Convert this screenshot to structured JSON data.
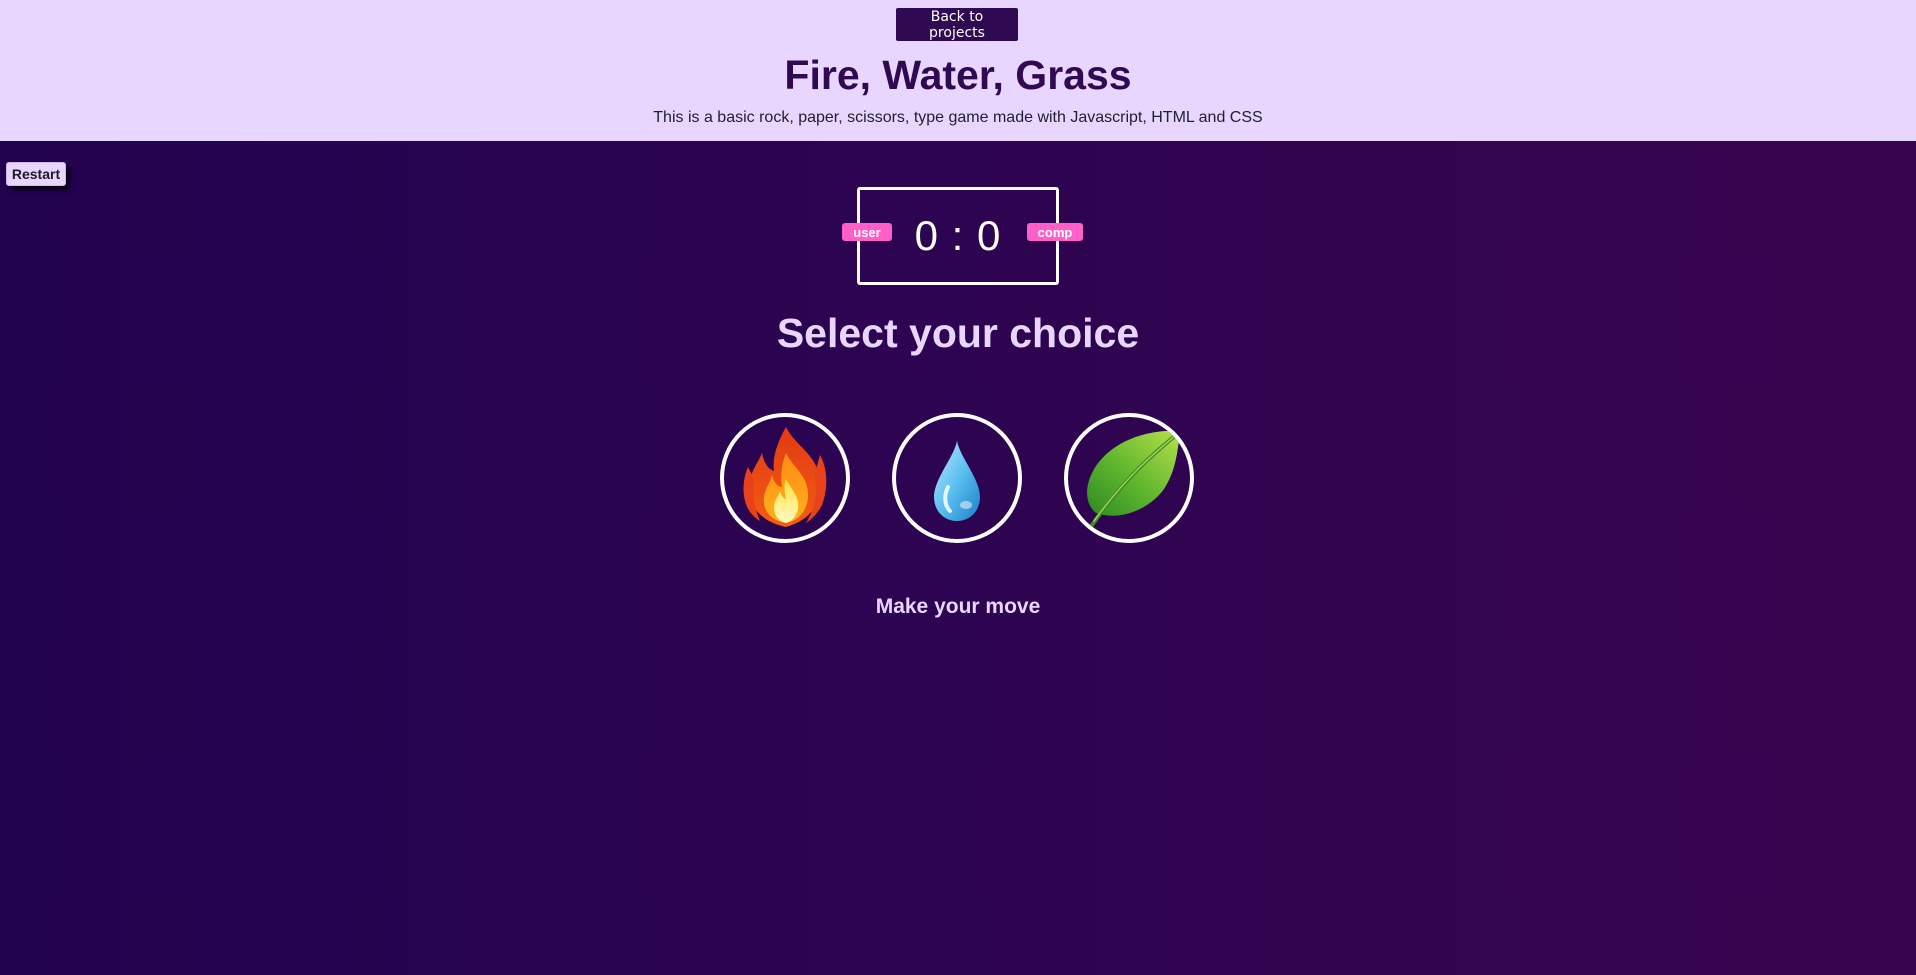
{
  "header": {
    "back_label": "Back to projects",
    "title": "Fire, Water, Grass",
    "subtitle": "This is a basic rock, paper, scissors, type game made with Javascript, HTML and CSS",
    "background_color": "#e8d6ff",
    "accent_color": "#2f0a52"
  },
  "game": {
    "restart_label": "Restart",
    "score": {
      "user_label": "user",
      "comp_label": "comp",
      "user_score": 0,
      "comp_score": 0,
      "display": "0 : 0"
    },
    "heading": "Select your choice",
    "choices": [
      {
        "id": "fire",
        "icon": "fire-icon"
      },
      {
        "id": "water",
        "icon": "water-drop-icon"
      },
      {
        "id": "grass",
        "icon": "leaf-icon"
      }
    ],
    "message": "Make your move",
    "badge_color": "#ff5fc7",
    "background_gradient": [
      "#22034f",
      "#38044f"
    ]
  }
}
